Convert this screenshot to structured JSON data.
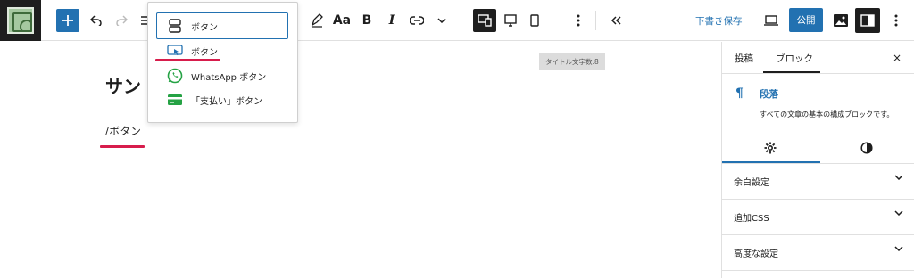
{
  "toolbar": {
    "add_block": "plus-icon",
    "undo": "undo-icon",
    "redo": "redo-icon",
    "typography": "Aa",
    "bold": "B",
    "italic": "I",
    "save_draft": "下書き保存",
    "publish": "公開"
  },
  "editor": {
    "title_counter": "タイトル文字数:8",
    "title": "サン",
    "slash_command": "/ボタン"
  },
  "inserter": {
    "items": [
      {
        "label": "ボタン",
        "icon": "buttons-icon"
      },
      {
        "label": "ボタン",
        "icon": "button-link-icon"
      },
      {
        "label": "WhatsApp ボタン",
        "icon": "whatsapp-icon"
      },
      {
        "label": "「支払い」ボタン",
        "icon": "payment-card-icon"
      }
    ]
  },
  "sidebar": {
    "tabs": [
      "投稿",
      "ブロック"
    ],
    "close": "×",
    "block_icon": "¶",
    "block_name": "段落",
    "block_description": "すべての文章の基本の構成ブロックです。",
    "panels": [
      "余白設定",
      "追加CSS",
      "高度な設定"
    ]
  },
  "colors": {
    "accent": "#2271b1",
    "highlight": "#d71d4c",
    "whatsapp": "#25a244",
    "dark": "#1e1e1e"
  }
}
